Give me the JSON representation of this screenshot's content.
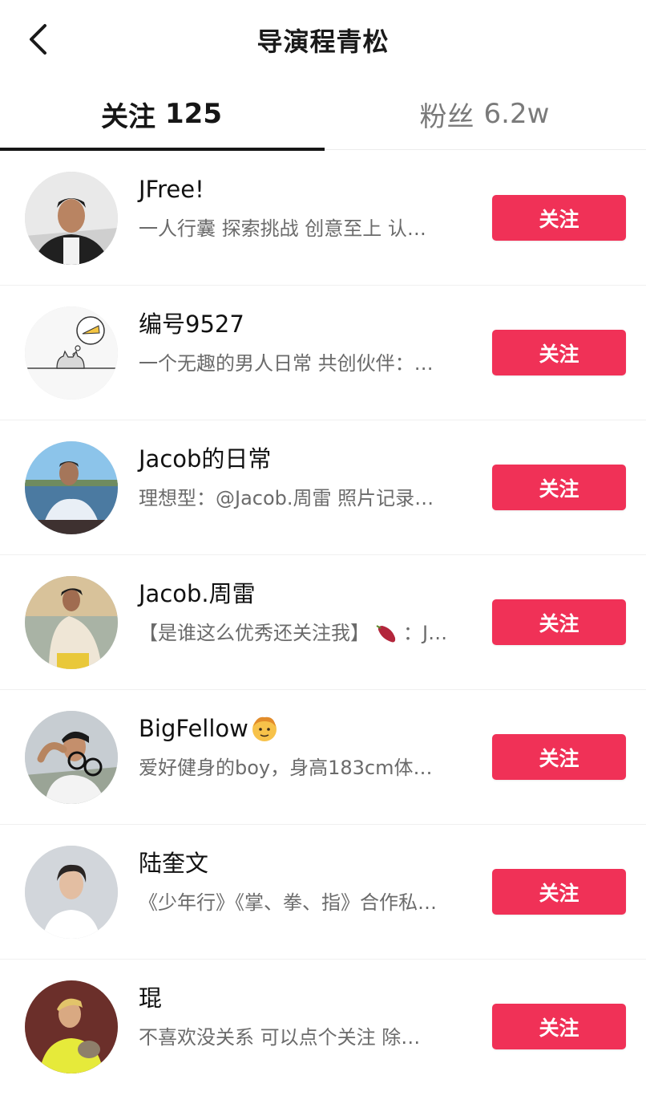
{
  "header": {
    "title": "导演程青松",
    "back_icon": "chevron-left-icon"
  },
  "tabs": [
    {
      "label": "关注",
      "count": "125",
      "active": true
    },
    {
      "label": "粉丝",
      "count": "6.2w",
      "active": false
    }
  ],
  "colors": {
    "accent": "#f03157",
    "text_primary": "#161616",
    "text_secondary": "#6b6b6b"
  },
  "users": [
    {
      "name": "JFree!",
      "desc": "一人行囊 探索挑战 创意至上 认…",
      "button": "关注"
    },
    {
      "name": "编号9527",
      "desc": "一个无趣的男人日常 共创伙伴：…",
      "button": "关注"
    },
    {
      "name": "Jacob的日常",
      "desc": "理想型：@Jacob.周雷 照片记录…",
      "button": "关注"
    },
    {
      "name": "Jacob.周雷",
      "desc_before": "【是谁这么优秀还关注我】",
      "desc_icon": "sweet-potato-icon",
      "desc_after": "：J…",
      "button": "关注"
    },
    {
      "name": "BigFellow",
      "name_icon": "face-emoji-icon",
      "desc": "爱好健身的boy，身高183cm体…",
      "button": "关注"
    },
    {
      "name": "陆奎文",
      "desc": "《少年行》《掌、拳、指》合作私…",
      "button": "关注"
    },
    {
      "name": "琨",
      "desc": "不喜欢没关系 可以点个关注 除…",
      "button": "关注"
    }
  ]
}
